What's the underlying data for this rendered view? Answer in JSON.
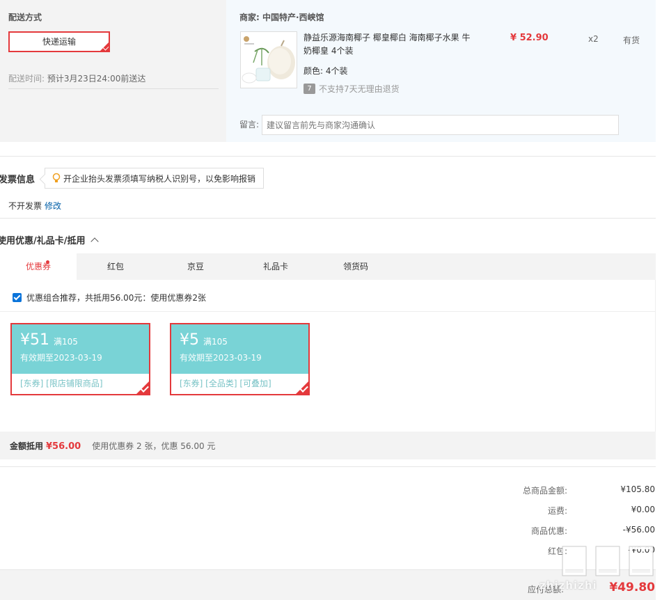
{
  "shipping": {
    "title": "配送方式",
    "option": "快递运输",
    "time_label": "配送时间:",
    "time_value": "预计3月23日24:00前送达"
  },
  "merchant": {
    "label": "商家:",
    "name": "中国特产·西峡馆"
  },
  "product": {
    "name": "静益乐源海南椰子 椰皇椰白 海南椰子水果 牛奶椰皇 4个装",
    "color_label": "颜色:",
    "color_value": "4个装",
    "return_icon_text": "7",
    "return_policy": "不支持7天无理由退货",
    "price": "¥ 52.90",
    "qty": "x2",
    "stock": "有货"
  },
  "message": {
    "label": "留言:",
    "placeholder": "建议留言前先与商家沟通确认"
  },
  "invoice": {
    "title": "发票信息",
    "tip": "开企业抬头发票须填写纳税人识别号，以免影响报销",
    "state": "不开发票",
    "edit_link": "修改"
  },
  "coupons": {
    "title": "使用优惠/礼品卡/抵用",
    "tabs": [
      "优惠券",
      "红包",
      "京豆",
      "礼品卡",
      "领货码"
    ],
    "active_tab": "优惠券",
    "combo_text": "优惠组合推荐，共抵用56.00元：使用优惠券2张",
    "items": [
      {
        "amount": "¥51",
        "condition": "满105",
        "valid": "有效期至2023-03-19",
        "tags": "[东券]  [限店铺限商品]"
      },
      {
        "amount": "¥5",
        "condition": "满105",
        "valid": "有效期至2023-03-19",
        "tags": "[东券]  [全品类]  [可叠加]"
      }
    ],
    "summary_label": "金额抵用",
    "summary_amount": "¥56.00",
    "summary_desc": "使用优惠券 2 张，优惠 56.00 元"
  },
  "totals": {
    "rows": [
      {
        "label": "总商品金额:",
        "value": "¥105.80"
      },
      {
        "label": "运费:",
        "value": "¥0.00"
      },
      {
        "label": "商品优惠:",
        "value": "-¥56.00"
      },
      {
        "label": "红包:",
        "value": "-¥0.00"
      }
    ],
    "final_label": "应付总额:",
    "final_value": "¥49.80"
  },
  "watermark": {
    "text": "zhizhizhi"
  },
  "colors": {
    "accent": "#e4393c",
    "coupon_teal": "#79d3d6",
    "link_blue": "#005ea7"
  }
}
